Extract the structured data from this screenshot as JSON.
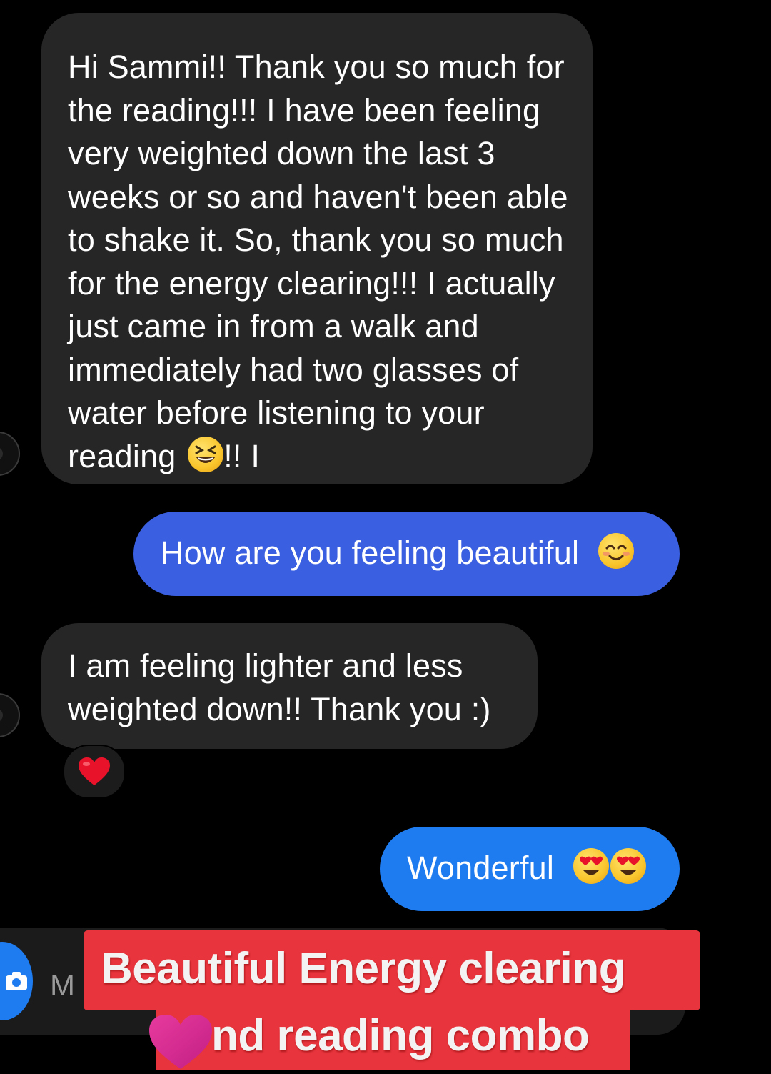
{
  "messages": [
    {
      "direction": "incoming",
      "text": "Hi Sammi!! Thank you so much for the reading!!! I have been feeling very weighted down the last 3 weeks or so and haven't been able to shake it. So, thank you so much for the energy clearing!!! I actually just came in from a walk and immediately had two glasses of water before listening to your reading",
      "emoji": "grinning-squinting-face",
      "trailing_text": "!! I"
    },
    {
      "direction": "outgoing",
      "text": "How are you feeling beautiful",
      "emoji": "smiling-face-with-smiling-eyes",
      "color": "#3a5fe0"
    },
    {
      "direction": "incoming",
      "text": "I am feeling lighter and less weighted down!! Thank you :)",
      "reaction": "red-heart"
    },
    {
      "direction": "outgoing",
      "text": "Wonderful",
      "emoji": "smiling-face-with-heart-eyes ×2",
      "color": "#1f7cf0"
    }
  ],
  "composer": {
    "placeholder": "M",
    "camera_icon": "camera-icon",
    "accent": "#1f7cf0"
  },
  "overlay": {
    "line1": "Beautiful Energy clearing",
    "line2": "nd reading combo",
    "background": "#e8343c",
    "sticker": "pink-heart"
  },
  "colors": {
    "background": "#000000",
    "incoming_bubble": "#262626",
    "text": "#ffffff"
  }
}
